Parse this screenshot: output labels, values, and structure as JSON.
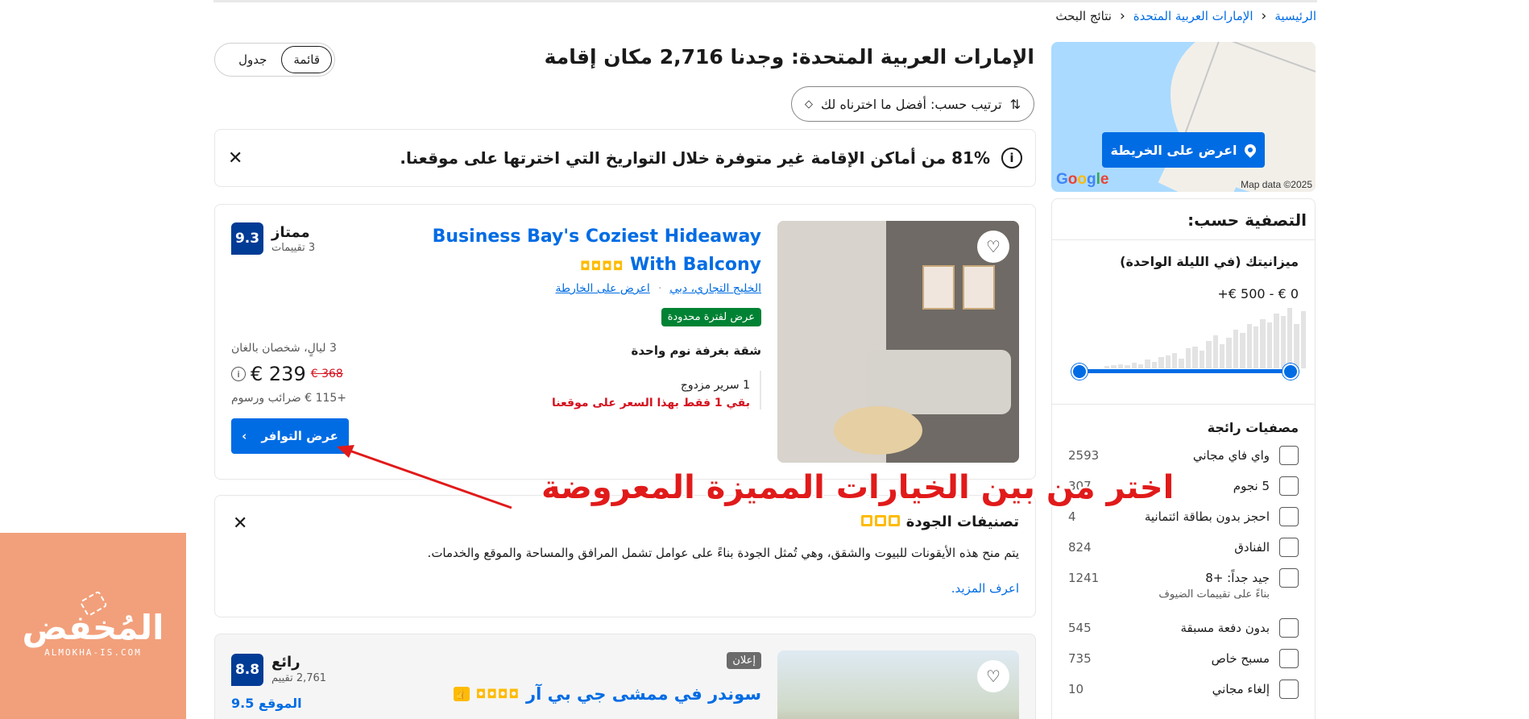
{
  "breadcrumb": {
    "home": "الرئيسية",
    "country": "الإمارات العربية المتحدة",
    "current": "نتائج البحث"
  },
  "map": {
    "button": "اعرض على الخريطة",
    "google": "Google",
    "attribution": "Map data ©2025"
  },
  "header": {
    "title": "الإمارات العربية المتحدة: وجدنا 2,716 مكان إقامة",
    "view_list": "قائمة",
    "view_grid": "جدول",
    "sort_label": "ترتيب حسب: أفضل ما اخترناه لك"
  },
  "banner": {
    "text": "81% من أماكن الإقامة غير متوفرة خلال التواريخ التي اخترتها على موقعنا."
  },
  "filters": {
    "title": "التصفية حسب:",
    "budget_title": "ميزانيتك (في الليلة الواحدة)",
    "budget_range": "0 € - 500 €+",
    "histogram": [
      2,
      3,
      4,
      3,
      5,
      4,
      8,
      6,
      10,
      12,
      14,
      9,
      18,
      20,
      16,
      25,
      30,
      22,
      28,
      35,
      32,
      40,
      38,
      45,
      42,
      50,
      48,
      55,
      40,
      52
    ],
    "popular_title": "مصفيات رائجة",
    "popular": [
      {
        "label": "واي فاي مجاني",
        "count": "2593",
        "sub": ""
      },
      {
        "label": "5 نجوم",
        "count": "307",
        "sub": ""
      },
      {
        "label": "احجز بدون بطاقة ائتمانية",
        "count": "4",
        "sub": ""
      },
      {
        "label": "الفنادق",
        "count": "824",
        "sub": ""
      },
      {
        "label": "جيد جداً: +8",
        "count": "1241",
        "sub": "بناءً على تقييمات الضيوف"
      },
      {
        "label": "بدون دفعة مسبقة",
        "count": "545",
        "sub": ""
      },
      {
        "label": "مسبح خاص",
        "count": "735",
        "sub": ""
      },
      {
        "label": "إلغاء مجاني",
        "count": "10",
        "sub": ""
      }
    ]
  },
  "card1": {
    "title": "Business Bay's Coziest Hideaway With Balcony",
    "stars": "◘◘◘◘",
    "location": "الخليج التجاري، دبي",
    "map_link": "اعرض على الخارطة",
    "deal": "عرض لفترة محدودة",
    "room_name": "شقة بغرفة نوم واحدة",
    "bed": "1 سرير مزدوج",
    "left": "بقي 1 فقط بهذا السعر على موقعنا",
    "score": "9.3",
    "score_word": "ممتاز",
    "reviews": "3 تقييمات",
    "stay_info": "3 ليالٍ، شخصان بالغان",
    "old_price": "€ 368",
    "new_price": "€ 239",
    "taxes": "+115 € ضرائب ورسوم",
    "button": "عرض التوافر"
  },
  "quality": {
    "title": "تصنيفات الجودة",
    "desc": "يتم منح هذه الأيقونات للبيوت والشقق، وهي تُمثل الجودة بناءً على عوامل تشمل المرافق والمساحة والموقع والخدمات.",
    "more": "اعرف المزيد."
  },
  "card2": {
    "ad": "إعلان",
    "title": "سوندر في ممشى جي بي آر",
    "stars": "◘◘◘◘",
    "score": "8.8",
    "score_word": "رائع",
    "reviews": "2,761 تقييم",
    "location_score": "الموقع 9.5"
  },
  "annotation": "اختر من بين الخيارات المميزة المعروضة",
  "watermark": {
    "name": "المُخفض",
    "site": "ALMOKHA-IS.COM"
  },
  "colors": {
    "primary": "#006ce4",
    "dark_blue": "#003b95",
    "deal_green": "#008234",
    "alert_red": "#d4111e",
    "star": "#febb02",
    "annotation": "#e11a1a",
    "watermark_bg": "#f2a07b"
  }
}
